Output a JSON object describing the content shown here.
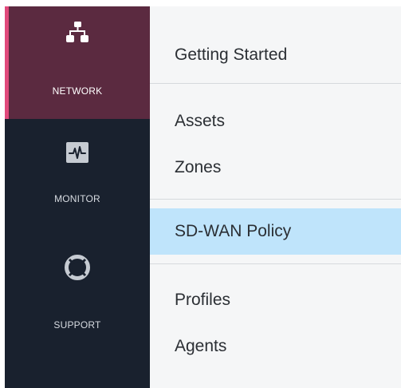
{
  "rail": {
    "items": [
      {
        "label": "NETWORK",
        "icon": "network-icon",
        "active": true
      },
      {
        "label": "MONITOR",
        "icon": "monitor-icon",
        "active": false
      },
      {
        "label": "SUPPORT",
        "icon": "support-icon",
        "active": false
      }
    ]
  },
  "menu": {
    "items": [
      {
        "label": "Getting Started"
      },
      {
        "label": "Assets"
      },
      {
        "label": "Zones"
      },
      {
        "label": "SD-WAN Policy",
        "selected": true
      },
      {
        "label": "Profiles"
      },
      {
        "label": "Agents"
      }
    ]
  },
  "colors": {
    "rail_bg": "#19212e",
    "rail_active_bg": "#5b2a40",
    "rail_active_accent": "#e0497b",
    "panel_bg": "#f5f6f7",
    "selected_bg": "#bfe4fb"
  }
}
